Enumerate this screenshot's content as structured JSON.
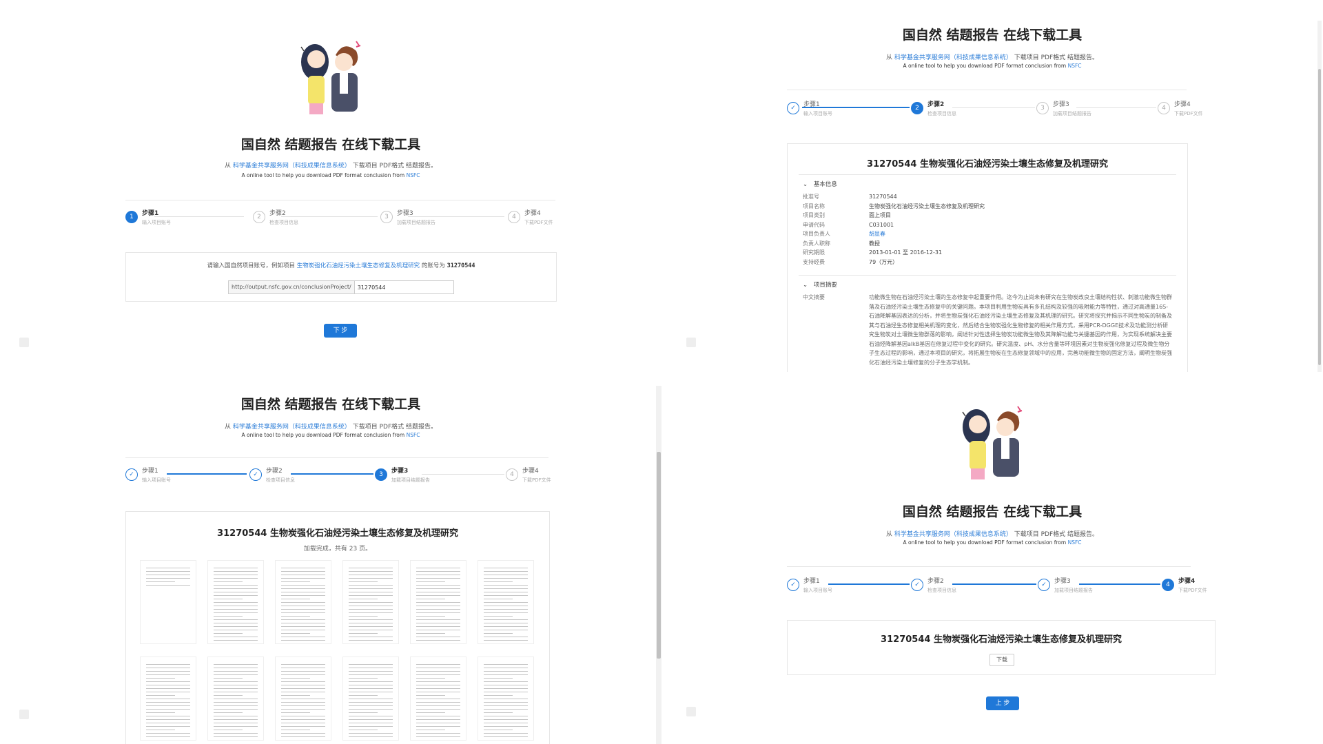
{
  "app": {
    "title": "国自然 结题报告 在线下载工具",
    "subtitle_prefix": "从",
    "subtitle_link": "科学基金共享服务网（科技成果信息系统）",
    "subtitle_suffix": "下载项目 PDF格式 结题报告。",
    "eng_text": "A online tool to help you download PDF format conclusion from",
    "eng_link": "NSFC"
  },
  "steps": [
    {
      "num": "1",
      "label": "步骤1",
      "desc": "输入项目账号"
    },
    {
      "num": "2",
      "label": "步骤2",
      "desc": "检查项目信息"
    },
    {
      "num": "3",
      "label": "步骤3",
      "desc": "加载项目结题报告"
    },
    {
      "num": "4",
      "label": "步骤4",
      "desc": "下载PDF文件"
    }
  ],
  "step1": {
    "hint_prefix": "请输入国自然项目账号，例如项目",
    "hint_link": "生物炭强化石油烃污染土壤生态修复及机理研究",
    "hint_middle": "的账号为",
    "hint_code": "31270544",
    "url_prefix": "http://output.nsfc.gov.cn/conclusionProject/",
    "input_value": "31270544",
    "next_button": "下 步"
  },
  "project": {
    "heading": "31270544 生物炭强化石油烃污染土壤生态修复及机理研究"
  },
  "step2": {
    "basic_info_label": "基本信息",
    "abstract_label": "项目摘要",
    "fields": [
      {
        "k": "批准号",
        "v": "31270544",
        "link": false
      },
      {
        "k": "项目名称",
        "v": "生物炭强化石油烃污染土壤生态修复及机理研究",
        "link": false
      },
      {
        "k": "项目类别",
        "v": "面上项目",
        "link": false
      },
      {
        "k": "申请代码",
        "v": "C031001",
        "link": false
      },
      {
        "k": "项目负责人",
        "v": "胡显春",
        "link": true
      },
      {
        "k": "负责人职称",
        "v": "教授",
        "link": false
      },
      {
        "k": "研究期限",
        "v": "2013-01-01 至 2016-12-31",
        "link": false
      },
      {
        "k": "支持经费",
        "v": "79（万元）",
        "link": false
      }
    ],
    "abstract_key": "中文摘要",
    "abstract_text": "功能微生物在石油烃污染土壤的生态修复中起重要作用。迄今为止尚未有研究在生物炭改良土壤结构性状、刺激功能微生物群落及石油烃污染土壤生态修复中的关键问题。本项目利用生物炭具有多孔结构及较强的吸附能力等特性，通过对高通量16S-石油降解基因表达的分析，并将生物炭强化石油烃污染土壤生态修复及其机理的研究。研究将探究并揭示不同生物炭的制备及其与石油烃生态修复相关机理的变化，然后结合生物炭强化生物修复的相关作用方式，采用PCR-DGGE技术及功能测分析研究生物炭对土壤微生物群落的影响，阐述针对性选择生物炭功能微生物及其降解功能与关键基因的作用，为实现系统解决主要石油烃降解基因alkB基因在修复过程中变化的研究。研究温度、pH、水分含量等环境因素对生物炭强化修复过程及微生物分子生态过程的影响，通过本项目的研究，将拓展生物炭在生态修复领域中的应用，完善功能微生物的固定方法，阐明生物炭强化石油烃污染土壤修复的分子生态学机制。"
  },
  "step3": {
    "status": "加载完成，共有 23 页。"
  },
  "step4": {
    "download_button": "下载",
    "prev_button": "上 步"
  }
}
